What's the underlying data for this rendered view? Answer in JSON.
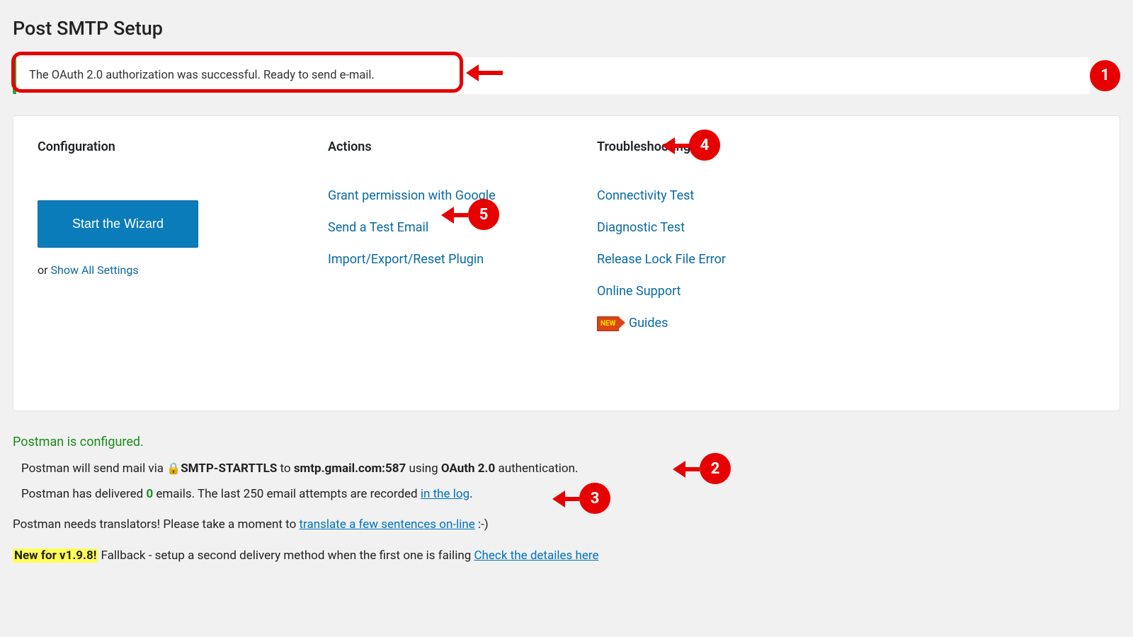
{
  "page_title": "Post SMTP Setup",
  "notice": "The OAuth 2.0 authorization was successful. Ready to send e-mail.",
  "panel": {
    "configuration": {
      "heading": "Configuration",
      "wizard_button": "Start the Wizard",
      "or_text": "or ",
      "show_all_link": "Show All Settings"
    },
    "actions": {
      "heading": "Actions",
      "links": {
        "grant": "Grant permission with Google",
        "test_email": "Send a Test Email",
        "import_export": "Import/Export/Reset Plugin"
      }
    },
    "troubleshooting": {
      "heading": "Troubleshooting",
      "links": {
        "connectivity": "Connectivity Test",
        "diagnostic": "Diagnostic Test",
        "release_lock": "Release Lock File Error",
        "online_support": "Online Support",
        "guides": "Guides",
        "new_badge": "NEW"
      }
    }
  },
  "status": {
    "configured_line": "Postman is configured.",
    "send_line": {
      "prefix": "Postman will send mail via ",
      "lock_icon": "🔒",
      "protocol": "SMTP-STARTTLS",
      "to_word": " to ",
      "host": "smtp.gmail.com:587",
      "using_word": " using ",
      "auth": "OAuth 2.0",
      "suffix": " authentication."
    },
    "delivered_line": {
      "prefix": "Postman has delivered ",
      "count": "0",
      "mid": " emails. The last 250 email attempts are recorded ",
      "log_link": "in the log",
      "suffix": "."
    }
  },
  "footer": {
    "translators": {
      "prefix": "Postman needs translators! Please take a moment to ",
      "link": "translate a few sentences on-line",
      "suffix": " :-)"
    },
    "new_feature": {
      "badge": "New for v1.9.8!",
      "text": " Fallback - setup a second delivery method when the first one is failing ",
      "link": "Check the detailes here"
    }
  },
  "callouts": {
    "c1": "1",
    "c2": "2",
    "c3": "3",
    "c4": "4",
    "c5": "5"
  }
}
